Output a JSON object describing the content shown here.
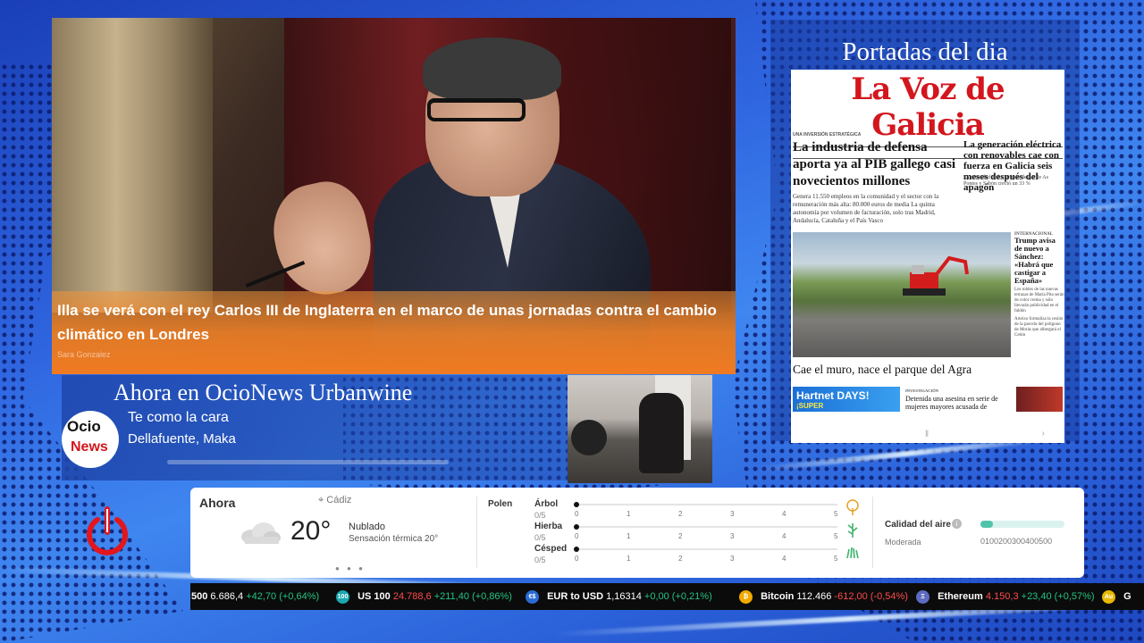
{
  "news": {
    "headline": "Illa se verá con el rey Carlos III de Inglaterra en el marco de unas jornadas contra el cambio climático en Londres",
    "credit": "Sara Gonzalez"
  },
  "portadas": {
    "title": "Portadas del dia",
    "newspaper": "La Voz de Galicia",
    "lead_tag": "UNA INVERSIÓN ESTRATÉGICA",
    "lead_headline": "La industria de defensa aporta ya al PIB gallego casi novecientos millones",
    "lead_body": "Genera 11.550 empleos en la comunidad y el sector con la remuneración más alta: 80.000 euros de media",
    "lead_body2": "La quinta autonomía por volumen de facturación, solo tras Madrid, Andalucía, Cataluña y el País Vasco",
    "side_headline": "La generación eléctrica con renovables cae con fuerza en Galicia seis meses después del apagón",
    "side_body": "La actividad de los grupos de gas de As Pontes y Sabón creció un 33 %",
    "intl_tag": "INTERNACIONAL",
    "intl_headline": "Trump avisa de nuevo a Sánchez: «Habrá que castigar a España»",
    "rc_body": "Los toldos de las nuevas terrazas de María Pita serán de color crema y sólo llevarán publicidad en el faldón",
    "rc_body2": "Arteixo formaliza la cesión de la parcela del polígono de Morás que albergará el Cetim",
    "photo_headline": "Cae el muro, nace el parque del Agra",
    "bottom_tag": "INVESTIGACIÓN",
    "bottom_text": "Detenida una asesina en serie de mujeres mayores acusada de",
    "ad_text": "Hartnet DAYS!",
    "ad_sub": "¡SUPER"
  },
  "now_playing": {
    "title": "Ahora en OcioNews Urbanwine",
    "song": "Te como la cara",
    "artist": "Dellafuente, Maka",
    "logo_top": "Ocio",
    "logo_bottom": "News"
  },
  "weather": {
    "now_label": "Ahora",
    "location": "Cádiz",
    "temperature": "20°",
    "condition": "Nublado",
    "feels_like": "Sensación térmica 20°",
    "pager": "● ● ●",
    "polen_label": "Polen",
    "polen": [
      {
        "name": "Árbol",
        "value": "0/5"
      },
      {
        "name": "Hierba",
        "value": "0/5"
      },
      {
        "name": "Césped",
        "value": "0/5"
      }
    ],
    "scale": [
      "0",
      "1",
      "2",
      "3",
      "4",
      "5"
    ],
    "air_quality_label": "Calidad del aire",
    "air_quality_value": "Moderada",
    "air_quality_scale": "0100200300400500",
    "air_quality_level": 0.15,
    "cloud_icon": "cloud-icon",
    "location_icon": "map-pin-icon"
  },
  "ticker": {
    "items": [
      {
        "icon": "",
        "name": "500",
        "price": "6.686,4",
        "change": "+42,70 (+0,64%)",
        "dir": "up"
      },
      {
        "icon": "100",
        "name": "US 100",
        "price": "24.788,6",
        "change": "+211,40 (+0,86%)",
        "dir": "up"
      },
      {
        "icon": "€$",
        "name": "EUR to USD",
        "price": "1,16314",
        "change": "+0,00 (+0,21%)",
        "dir": "up"
      },
      {
        "icon": "₿",
        "name": "Bitcoin",
        "price": "112.466",
        "change": "-612,00 (-0,54%)",
        "dir": "dn"
      },
      {
        "icon": "Ξ",
        "name": "Ethereum",
        "price": "4.150,3",
        "change": "+23,40 (+0,57%)",
        "dir": "up"
      },
      {
        "icon": "Au",
        "name": "G",
        "price": "",
        "change": "",
        "dir": "up"
      }
    ]
  },
  "colors": {
    "accent_orange": "#f07a22",
    "brand_red": "#d3161d",
    "up": "#26c281",
    "down": "#ff4b4b",
    "ticker_bg": "#0b0b0b"
  }
}
